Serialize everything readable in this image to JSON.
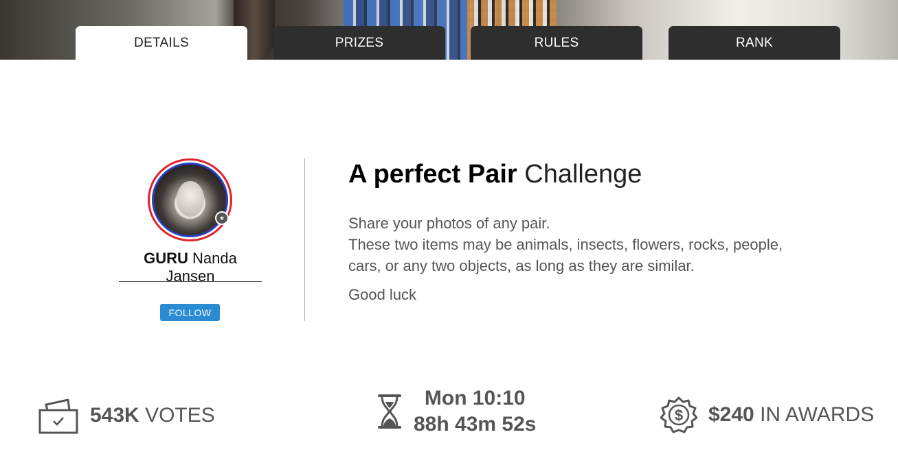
{
  "tabs": [
    {
      "label": "DETAILS",
      "active": true
    },
    {
      "label": "PRIZES",
      "active": false
    },
    {
      "label": "RULES",
      "active": false
    },
    {
      "label": "RANK",
      "active": false
    }
  ],
  "creator": {
    "rank": "GURU",
    "name": "Nanda Jansen",
    "follow_label": "FOLLOW"
  },
  "challenge": {
    "title_bold": "A perfect Pair",
    "title_suffix": "Challenge",
    "description": [
      "Share your photos of any pair.",
      "These two items may be animals, insects, flowers, rocks, people, cars, or any two objects, as long as they are similar."
    ],
    "closing": "Good luck"
  },
  "stats": {
    "votes_value": "543K",
    "votes_label": "VOTES",
    "end_time": "Mon 10:10",
    "countdown": "88h 43m 52s",
    "awards_value": "$240",
    "awards_label": "IN AWARDS"
  },
  "colors": {
    "tab_dark": "#2e2e2e",
    "follow_blue": "#2a8ad2",
    "avatar_ring_red": "#e0232a",
    "avatar_ring_blue": "#2c3fc0",
    "stat_gray": "#555555"
  },
  "icons": {
    "votes": "ballot-box-icon",
    "timer": "hourglass-icon",
    "awards": "dollar-badge-icon"
  }
}
